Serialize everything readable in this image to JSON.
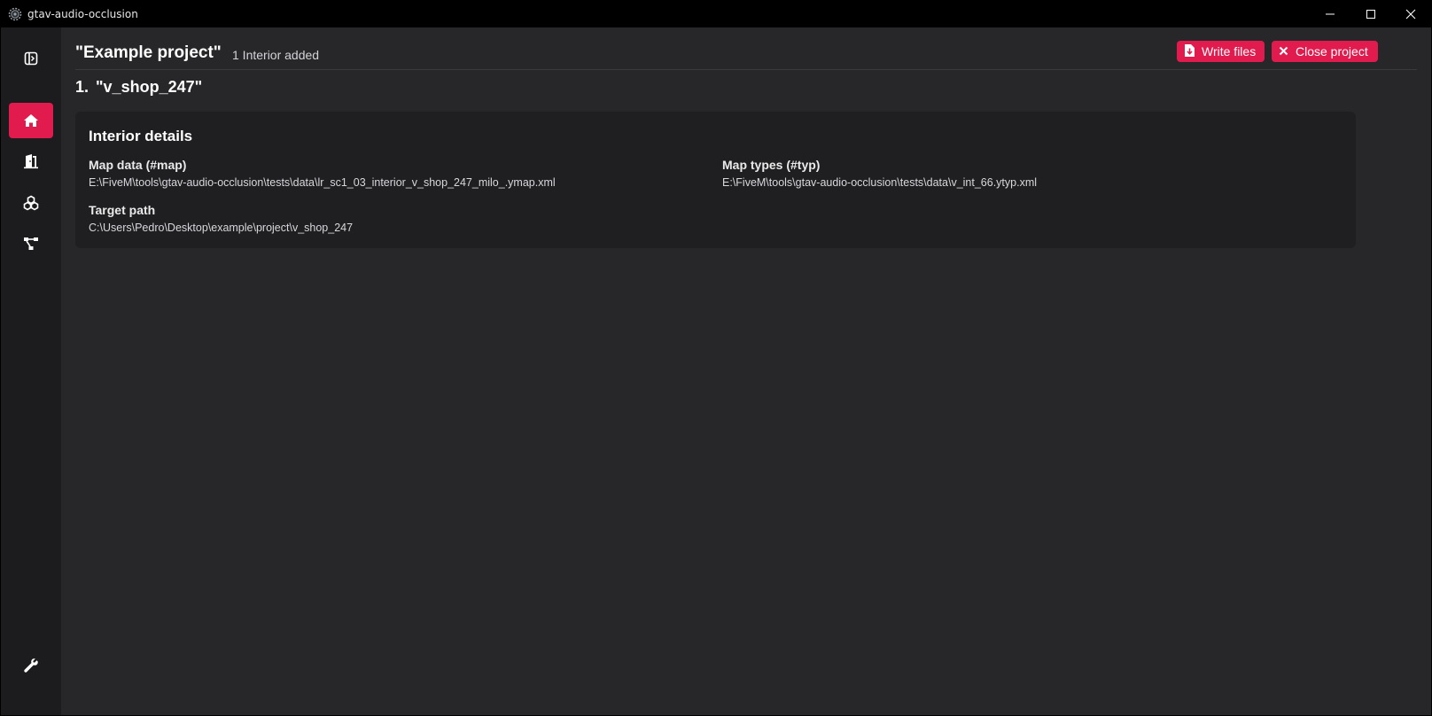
{
  "window": {
    "title": "gtav-audio-occlusion"
  },
  "icons": {
    "app": "gear-app-icon",
    "minimize": "minimize-icon",
    "maximize": "maximize-icon",
    "close": "close-icon"
  },
  "sidebar": {
    "items": [
      {
        "name": "toggle-sidebar",
        "icon": "sidebar-toggle-icon",
        "active": false
      },
      {
        "name": "home",
        "icon": "home-icon",
        "active": true
      },
      {
        "name": "portals",
        "icon": "door-icon",
        "active": false
      },
      {
        "name": "entities",
        "icon": "cubes-icon",
        "active": false
      },
      {
        "name": "nodes",
        "icon": "network-icon",
        "active": false
      },
      {
        "name": "settings",
        "icon": "wrench-icon",
        "active": false
      }
    ]
  },
  "header": {
    "project_title": "\"Example project\"",
    "interior_count": "1 Interior added",
    "write_files_label": "Write files",
    "close_project_label": "Close project"
  },
  "interior": {
    "index": "1.",
    "name": "\"v_shop_247\""
  },
  "details": {
    "title": "Interior details",
    "map_data_label": "Map data (#map)",
    "map_data_value": "E:\\FiveM\\tools\\gtav-audio-occlusion\\tests\\data\\lr_sc1_03_interior_v_shop_247_milo_.ymap.xml",
    "map_types_label": "Map types (#typ)",
    "map_types_value": "E:\\FiveM\\tools\\gtav-audio-occlusion\\tests\\data\\v_int_66.ytyp.xml",
    "target_path_label": "Target path",
    "target_path_value": "C:\\Users\\Pedro\\Desktop\\example\\project\\v_shop_247"
  },
  "colors": {
    "accent": "#e21b4e",
    "background": "#27272a",
    "sidebar": "#1c1c1e",
    "card": "#1f1f22",
    "titlebar": "#000000"
  }
}
